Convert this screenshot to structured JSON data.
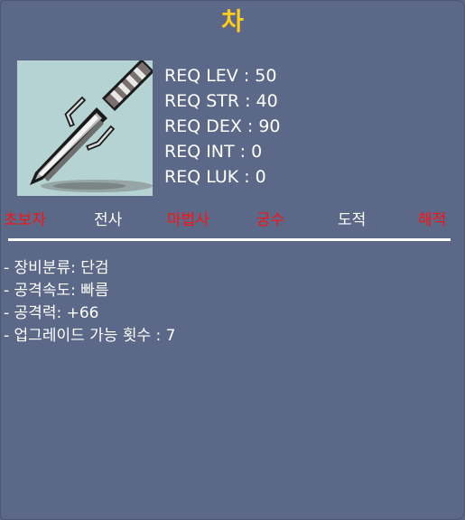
{
  "item": {
    "name": "차",
    "icon": "dagger-sprite-icon"
  },
  "requirements": [
    "REQ LEV : 50",
    "REQ STR : 40",
    "REQ DEX : 90",
    "REQ INT : 0",
    "REQ LUK : 0"
  ],
  "classes": [
    {
      "label": "초보자",
      "allowed": false
    },
    {
      "label": "전사",
      "allowed": true
    },
    {
      "label": "마법사",
      "allowed": false
    },
    {
      "label": "궁수",
      "allowed": false
    },
    {
      "label": "도적",
      "allowed": true
    },
    {
      "label": "해적",
      "allowed": false
    }
  ],
  "description": [
    "- 장비분류: 단검",
    "- 공격속도: 빠름",
    "- 공격력: +66",
    "- 업그레이드 가능 횟수 : 7"
  ],
  "colors": {
    "background": "#5b6887",
    "title": "#ffcc1a",
    "allowed": "#ffffff",
    "not_allowed": "#ff1010",
    "icon_background": "#b5d3d3"
  }
}
